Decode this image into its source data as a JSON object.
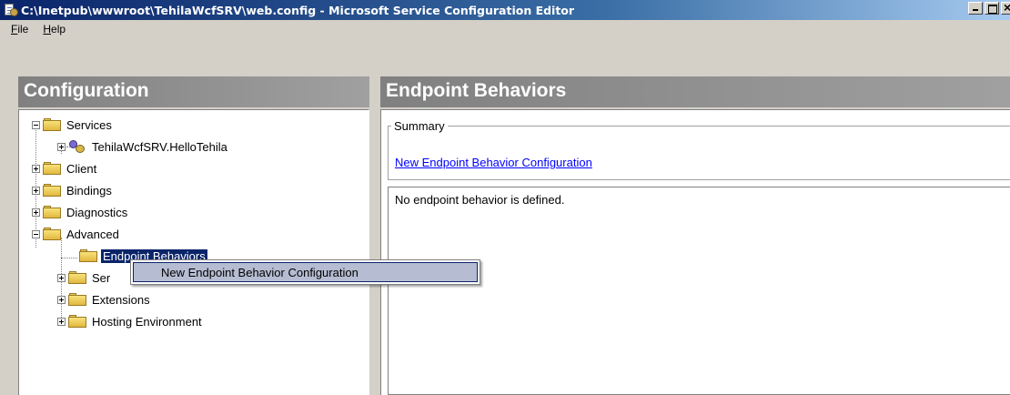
{
  "window": {
    "title": "C:\\Inetpub\\wwwroot\\TehilaWcfSRV\\web.config - Microsoft Service Configuration Editor"
  },
  "menu": {
    "file": {
      "first": "F",
      "rest": "ile"
    },
    "help": {
      "first": "H",
      "rest": "elp"
    }
  },
  "left_pane": {
    "header": "Configuration",
    "tree": {
      "services": "Services",
      "hello_service": "TehilaWcfSRV.HelloTehila",
      "client": "Client",
      "bindings": "Bindings",
      "diagnostics": "Diagnostics",
      "advanced": "Advanced",
      "endpoint_behaviors": "Endpoint Behaviors",
      "service_behaviors_partial": "Ser",
      "extensions": "Extensions",
      "hosting_environment": "Hosting Environment"
    }
  },
  "right_pane": {
    "header": "Endpoint Behaviors",
    "summary_legend": "Summary",
    "new_link": "New Endpoint Behavior Configuration",
    "info_text": "No endpoint behavior is defined."
  },
  "context_menu": {
    "item": "New Endpoint Behavior Configuration"
  },
  "colors": {
    "title_bar": "#0a246a",
    "selection": "#0a246a",
    "link": "#0000ff",
    "pane_header": "#808080",
    "folder": "#f0d060"
  }
}
